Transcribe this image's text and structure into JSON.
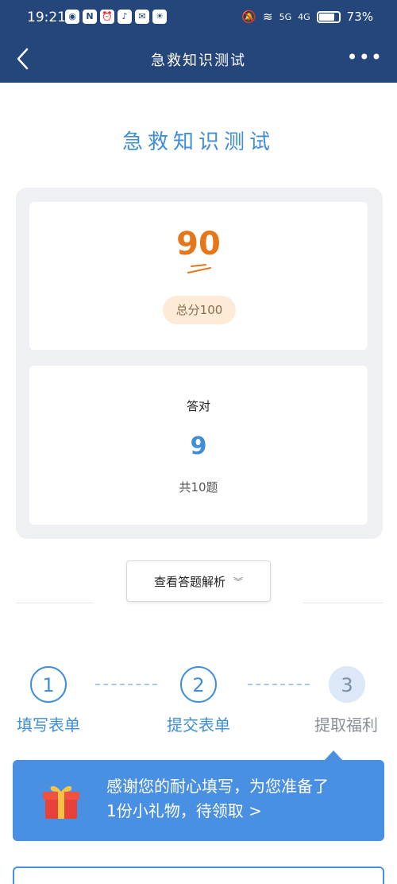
{
  "status_bar": {
    "time": "19:21",
    "network_5g": "5G",
    "network_4g": "4G",
    "battery": "73%",
    "battery_fraction": 0.73
  },
  "nav": {
    "title": "急救知识测试",
    "more": "•••"
  },
  "page_title": "急救知识测试",
  "score": {
    "value": "90",
    "total_label": "总分100"
  },
  "correct": {
    "label": "答对",
    "count": "9",
    "total_label": "共10题"
  },
  "view_analysis_button": "查看答题解析",
  "steps": [
    {
      "number": "1",
      "label": "填写表单",
      "state": "done"
    },
    {
      "number": "2",
      "label": "提交表单",
      "state": "done"
    },
    {
      "number": "3",
      "label": "提取福利",
      "state": "current"
    }
  ],
  "gift_banner": {
    "line1": "感谢您的耐心填写，为您准备了",
    "line2": "1份小礼物，待领取 >"
  },
  "colors": {
    "header": "#25467a",
    "accent": "#3f8ed8",
    "score": "#e5761a",
    "banner": "#4a90e2"
  }
}
